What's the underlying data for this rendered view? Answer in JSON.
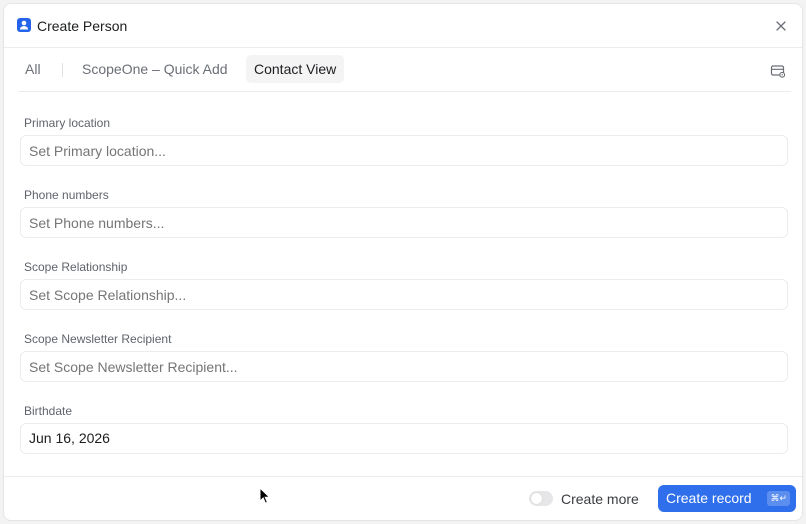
{
  "header": {
    "title": "Create Person"
  },
  "tabs": [
    {
      "label": "All",
      "active": false
    },
    {
      "label": "ScopeOne – Quick Add",
      "active": false
    },
    {
      "label": "Contact View",
      "active": true
    }
  ],
  "fields": [
    {
      "label": "Primary location",
      "placeholder": "Set Primary location...",
      "value": ""
    },
    {
      "label": "Phone numbers",
      "placeholder": "Set Phone numbers...",
      "value": ""
    },
    {
      "label": "Scope Relationship",
      "placeholder": "Set Scope Relationship...",
      "value": ""
    },
    {
      "label": "Scope Newsletter Recipient",
      "placeholder": "Set Scope Newsletter Recipient...",
      "value": ""
    },
    {
      "label": "Birthdate",
      "placeholder": "",
      "value": "Jun 16, 2026"
    }
  ],
  "footer": {
    "toggle_label": "Create more",
    "toggle_on": false,
    "create_label": "Create record",
    "create_shortcut": "⌘↵"
  },
  "colors": {
    "accent": "#2f6feb",
    "icon": "#2563eb"
  },
  "icons": {
    "header": "person-icon",
    "close": "close-icon",
    "tabs_right": "settings-panel-icon"
  }
}
